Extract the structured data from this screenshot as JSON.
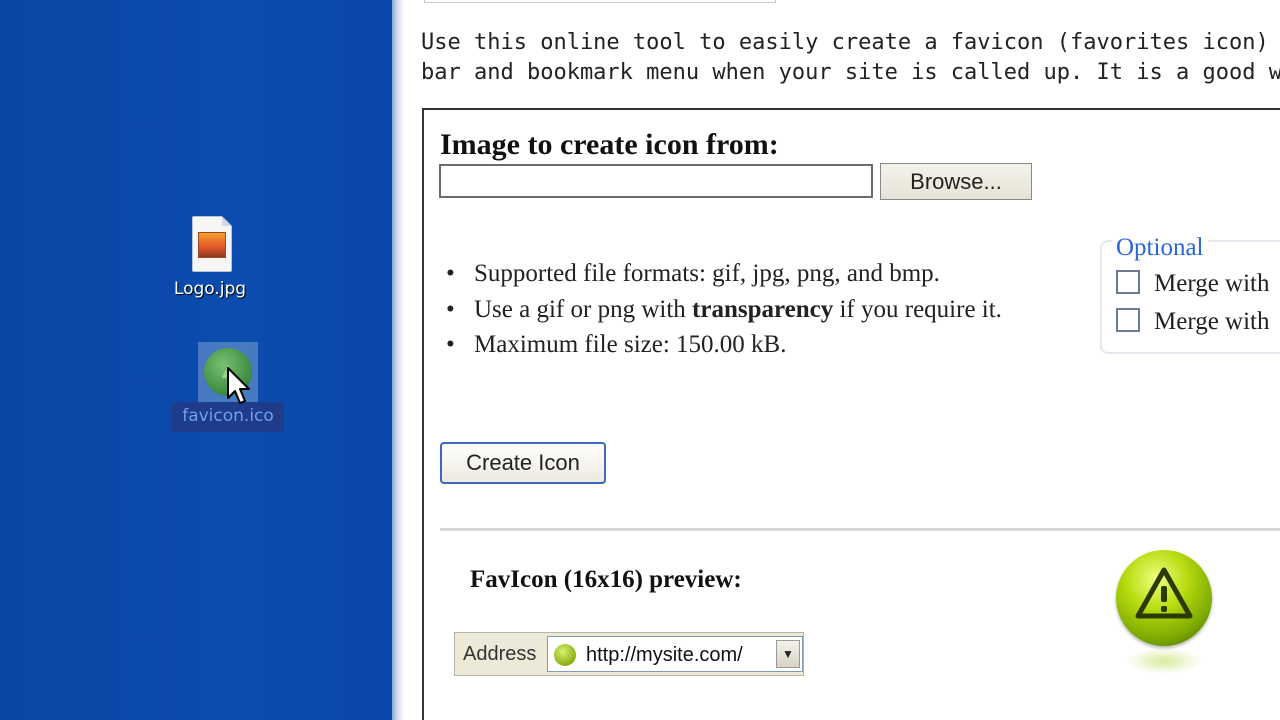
{
  "desktop": {
    "icons": [
      {
        "label": "Logo.jpg"
      },
      {
        "label": "favicon.ico"
      }
    ]
  },
  "page": {
    "intro_line1": "Use this online tool to easily create a favicon (favorites icon) for you",
    "intro_line2": "bar and bookmark menu when your site is called up. It is a good way",
    "form_title": "Image to create icon from:",
    "browse_label": "Browse...",
    "bullets": [
      {
        "text": "Supported file formats: gif, jpg, png, and bmp."
      },
      {
        "before": "Use a gif or png with ",
        "bold": "transparency",
        "after": " if you require it."
      },
      {
        "text": "Maximum file size: 150.00 kB."
      }
    ],
    "optional": {
      "legend": "Optional",
      "options": [
        "Merge with",
        "Merge with"
      ]
    },
    "create_label": "Create Icon",
    "preview_title": "FavIcon (16x16) preview:",
    "address": {
      "label": "Address",
      "url": "http://mysite.com/"
    }
  }
}
